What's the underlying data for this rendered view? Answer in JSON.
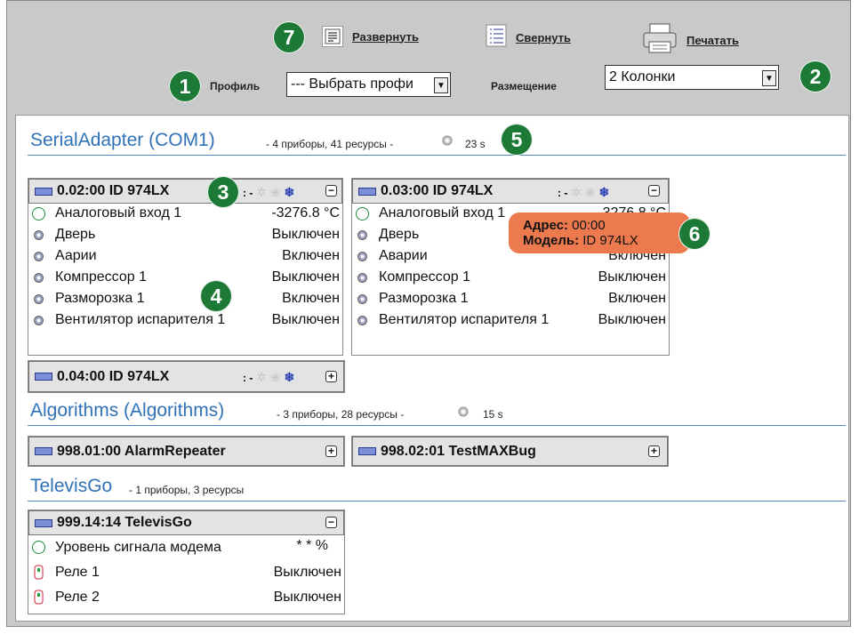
{
  "toolbar": {
    "expand_label": "Развернуть",
    "collapse_label": "Свернуть",
    "print_label": "Печатать",
    "profile_label": "Профиль",
    "profile_value": "--- Выбрать профи",
    "layout_label": "Размещение",
    "layout_value": "2 Колонки"
  },
  "badges": {
    "b1": "1",
    "b2": "2",
    "b3": "3",
    "b4": "4",
    "b5": "5",
    "b6": "6",
    "b7": "7"
  },
  "sections": [
    {
      "title": "SerialAdapter (COM1)",
      "meta": "- 4 приборы, 41 ресурсы -",
      "time": "23 s"
    },
    {
      "title": "Algorithms (Algorithms)",
      "meta": "- 3 приборы, 28 ресурсы -",
      "time": "15 s"
    },
    {
      "title": "TelevisGo",
      "meta": "- 1 приборы, 3 ресурсы"
    }
  ],
  "cards": {
    "c1": {
      "name": "0.02:00  ID 974LX",
      "rows": [
        {
          "name": "Аналоговый вход 1",
          "value": "-3276.8 °C"
        },
        {
          "name": "Дверь",
          "value": "Выключен"
        },
        {
          "name": "Аарии",
          "value": "Включен"
        },
        {
          "name": "Компрессор 1",
          "value": "Выключен"
        },
        {
          "name": "Разморозка 1",
          "value": "Включен"
        },
        {
          "name": "Вентилятор испарителя 1",
          "value": "Выключен"
        }
      ]
    },
    "c2": {
      "name": "0.03:00  ID 974LX",
      "rows": [
        {
          "name": "Аналоговый вход 1",
          "value": "-3276.8 °C"
        },
        {
          "name": "Дверь",
          "value": ""
        },
        {
          "name": "Аварии",
          "value": "Включен"
        },
        {
          "name": "Компрессор 1",
          "value": "Выключен"
        },
        {
          "name": "Разморозка 1",
          "value": "Включен"
        },
        {
          "name": "Вентилятор испарителя 1",
          "value": "Выключен"
        }
      ]
    },
    "c3": {
      "name": "0.04:00  ID 974LX"
    },
    "c4": {
      "name": "998.01:00 AlarmRepeater"
    },
    "c5": {
      "name": "998.02:01 TestMAXBug"
    },
    "c6": {
      "name": "999.14:14 TelevisGo",
      "rows": [
        {
          "name": "Уровень сигнала модема",
          "value": "* * %"
        },
        {
          "name": "Реле 1",
          "value": "Выключен"
        },
        {
          "name": "Реле 2",
          "value": "Выключен"
        }
      ]
    }
  },
  "tooltip": {
    "address_label": "Адрес:",
    "address_value": "00:00",
    "model_label": "Модель:",
    "model_value": "ID 974LX"
  },
  "colors": {
    "badge": "#1d7a36",
    "section_title": "#2f72b8",
    "tooltip": "#ed7a4f",
    "toolbar_bg": "#c9c9c9"
  }
}
